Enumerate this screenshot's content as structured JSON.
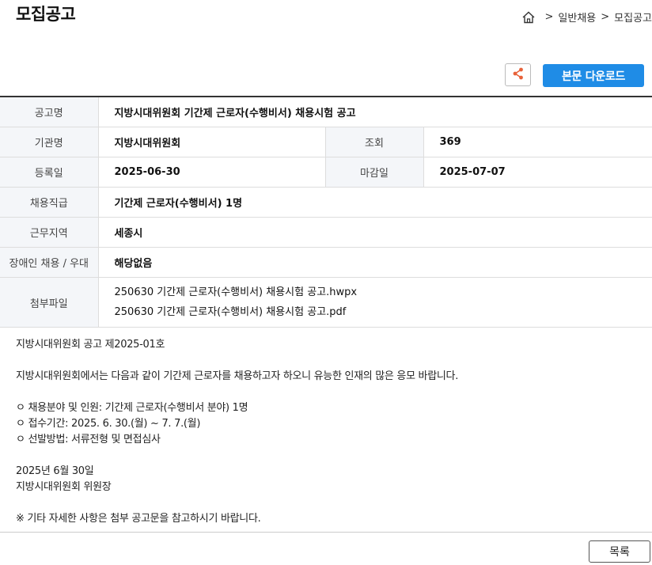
{
  "header": {
    "title": "모집공고",
    "breadcrumb": {
      "sep1": ">",
      "item1": "일반채용",
      "sep2": ">",
      "item2": "모집공고"
    }
  },
  "toolbar": {
    "download_label": "본문 다운로드"
  },
  "info": {
    "rows": {
      "title": {
        "label": "공고명",
        "value": "지방시대위원회 기간제 근로자(수행비서) 채용시험 공고"
      },
      "org": {
        "label": "기관명",
        "value": "지방시대위원회"
      },
      "views": {
        "label": "조회",
        "value": "369"
      },
      "registered": {
        "label": "등록일",
        "value": "2025-06-30"
      },
      "deadline": {
        "label": "마감일",
        "value": "2025-07-07"
      },
      "position": {
        "label": "채용직급",
        "value": "기간제 근로자(수행비서) 1명"
      },
      "location": {
        "label": "근무지역",
        "value": "세종시"
      },
      "disability": {
        "label": "장애인 채용 / 우대",
        "value": "해당없음"
      },
      "attachments": {
        "label": "첨부파일",
        "files": [
          "250630 기간제 근로자(수행비서) 채용시험 공고.hwpx",
          "250630 기간제 근로자(수행비서) 채용시험 공고.pdf"
        ]
      }
    }
  },
  "content": {
    "lines": [
      "지방시대위원회 공고 제2025-01호",
      "",
      "지방시대위원회에서는 다음과 같이 기간제 근로자를 채용하고자 하오니 유능한 인재의 많은 응모 바랍니다.",
      "",
      "ㅇ 채용분야 및 인원: 기간제 근로자(수행비서 분야) 1명",
      "ㅇ 접수기간: 2025. 6. 30.(월) ~ 7. 7.(월)",
      "ㅇ 선발방법: 서류전형 및 면접심사",
      "",
      "2025년 6월 30일",
      "지방시대위원회 위원장",
      "",
      "※ 기타 자세한 사항은 첨부 공고문을 참고하시기 바랍니다."
    ]
  },
  "footer": {
    "list_label": "목록"
  },
  "colors": {
    "accent": "#1f8ce6",
    "share_icon": "#e8623a"
  }
}
